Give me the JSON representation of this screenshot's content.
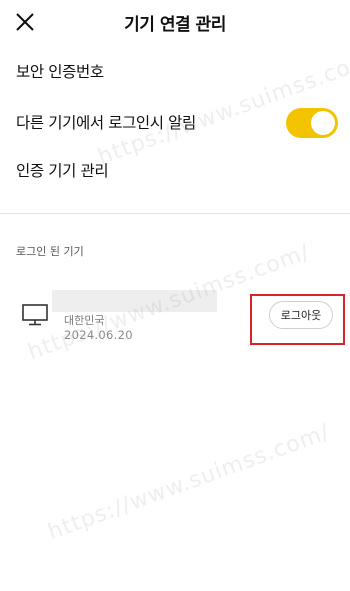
{
  "header": {
    "title": "기기 연결 관리",
    "close_icon": "close-icon"
  },
  "menu": {
    "security_code": "보안 인증번호",
    "login_alert": "다른 기기에서 로그인시 알림",
    "login_alert_enabled": true,
    "verified_devices": "인증 기기 관리"
  },
  "section": {
    "logged_in_label": "로그인 된 기기"
  },
  "device": {
    "icon": "monitor-icon",
    "country": "대한민국",
    "date": "2024.06.20",
    "logout_label": "로그아웃"
  },
  "watermark": {
    "text": "https://www.suimss.com/"
  },
  "colors": {
    "toggle_on": "#f4c300",
    "highlight": "#d8232a"
  }
}
